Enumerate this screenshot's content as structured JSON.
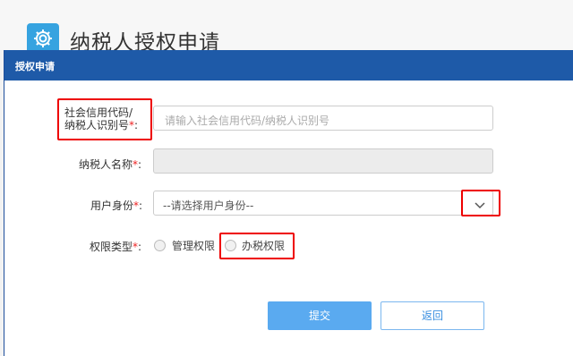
{
  "page": {
    "title": "纳税人授权申请",
    "icon": "gear-icon"
  },
  "dialog": {
    "title": "授权申请"
  },
  "form": {
    "credit_code": {
      "label_line1": "社会信用代码/",
      "label_line2": "纳税人识别号",
      "required_mark": "*",
      "colon": ":",
      "placeholder": "请输入社会信用代码/纳税人识别号"
    },
    "taxpayer_name": {
      "label": "纳税人名称",
      "required_mark": "*",
      "colon": ":",
      "value": ""
    },
    "user_identity": {
      "label": "用户身份",
      "required_mark": "*",
      "colon": ":",
      "selected": "--请选择用户身份--",
      "icon": "chevron-down-icon"
    },
    "permission_type": {
      "label": "权限类型",
      "required_mark": "*",
      "colon": ":",
      "options": [
        {
          "label": "管理权限"
        },
        {
          "label": "办税权限"
        }
      ]
    }
  },
  "buttons": {
    "submit": "提交",
    "back": "返回"
  },
  "colors": {
    "accent": "#1e5aa8",
    "highlight": "#e00000",
    "submit": "#5aaaf0"
  }
}
